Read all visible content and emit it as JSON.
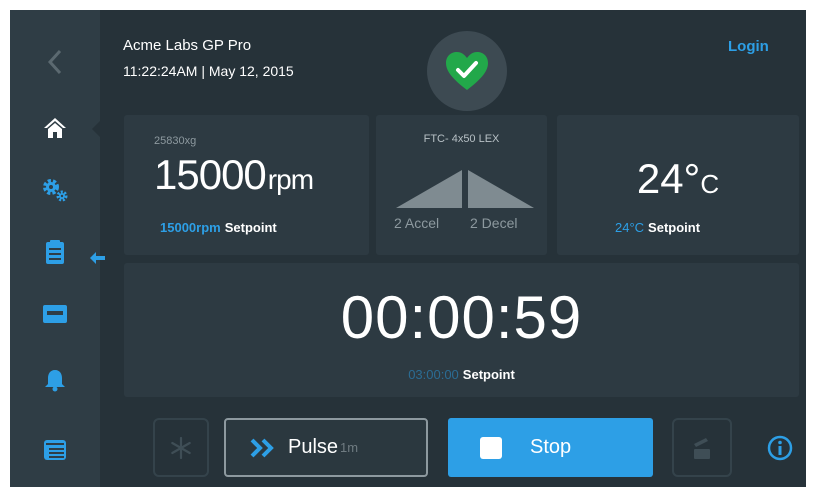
{
  "header": {
    "device_name": "Acme Labs GP Pro",
    "datetime": "11:22:24AM | May 12, 2015",
    "login_label": "Login",
    "status_icon": "heart-check-icon",
    "status_color": "#22a84a"
  },
  "sidebar": {
    "items": [
      {
        "icon": "back-arrow-icon"
      },
      {
        "icon": "home-icon",
        "active": true
      },
      {
        "icon": "gears-icon"
      },
      {
        "icon": "clipboard-icon"
      },
      {
        "icon": "display-panel-icon"
      },
      {
        "icon": "bell-icon"
      },
      {
        "icon": "list-card-icon"
      }
    ]
  },
  "speed": {
    "g_force": "25830xg",
    "value": "15000",
    "unit": "rpm",
    "setpoint_value": "15000rpm",
    "setpoint_label": "Setpoint"
  },
  "rotor": {
    "name": "FTC- 4x50 LEX",
    "accel": "2 Accel",
    "decel": "2 Decel"
  },
  "temperature": {
    "value": "24°",
    "unit": "C",
    "setpoint_value": "24°C",
    "setpoint_label": "Setpoint"
  },
  "timer": {
    "value": "00:00:59",
    "setpoint_value": "03:00:00",
    "setpoint_label": "Setpoint"
  },
  "controls": {
    "pulse_label": "Pulse",
    "pulse_sub": "1m",
    "stop_label": "Stop"
  },
  "colors": {
    "accent": "#2d9fe6",
    "background": "#263239",
    "panel": "#2d3a42",
    "sidebar": "#2f3d45"
  }
}
